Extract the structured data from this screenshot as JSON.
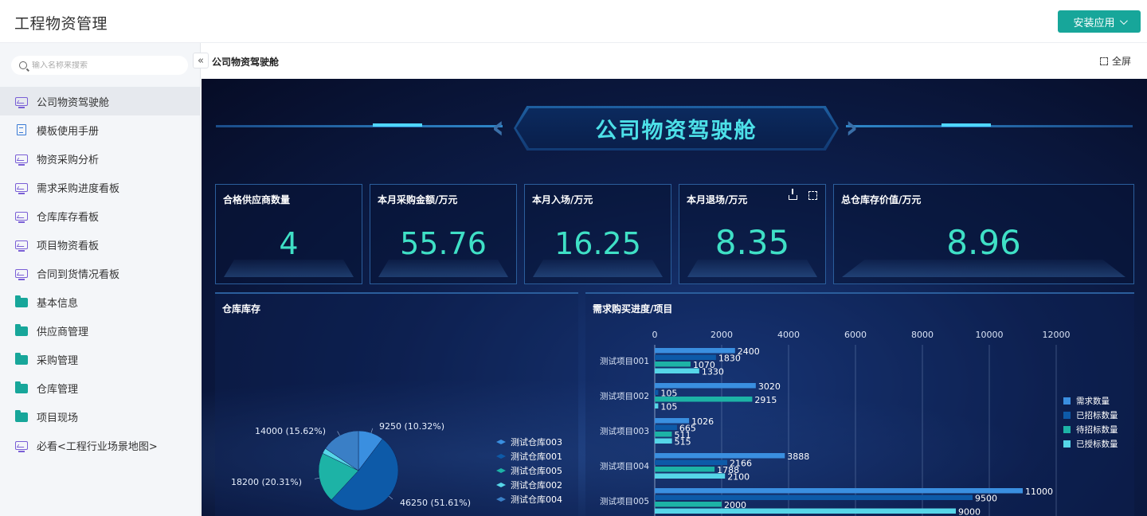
{
  "header": {
    "app_title": "工程物资管理",
    "install_label": "安装应用"
  },
  "sidebar": {
    "search_placeholder": "输入名称来搜索",
    "collapse_symbol": "«",
    "items": [
      {
        "label": "公司物资驾驶舱",
        "icon": "dashboard-screen-icon",
        "active": true
      },
      {
        "label": "模板使用手册",
        "icon": "document-icon"
      },
      {
        "label": "物资采购分析",
        "icon": "dashboard-screen-icon"
      },
      {
        "label": "需求采购进度看板",
        "icon": "dashboard-screen-icon"
      },
      {
        "label": "仓库库存看板",
        "icon": "dashboard-screen-icon"
      },
      {
        "label": "项目物资看板",
        "icon": "dashboard-screen-icon"
      },
      {
        "label": "合同到货情况看板",
        "icon": "dashboard-screen-icon"
      },
      {
        "label": "基本信息",
        "icon": "folder-icon"
      },
      {
        "label": "供应商管理",
        "icon": "folder-icon"
      },
      {
        "label": "采购管理",
        "icon": "folder-icon"
      },
      {
        "label": "仓库管理",
        "icon": "folder-icon"
      },
      {
        "label": "项目现场",
        "icon": "folder-icon"
      },
      {
        "label": "必看<工程行业场景地图>",
        "icon": "dashboard-screen-icon"
      }
    ]
  },
  "breadcrumb": {
    "current": "公司物资驾驶舱",
    "fullscreen_label": "全屏"
  },
  "dashboard": {
    "title": "公司物资驾驶舱",
    "kpis": [
      {
        "label": "合格供应商数量",
        "value": "4"
      },
      {
        "label": "本月采购金额/万元",
        "value": "55.76"
      },
      {
        "label": "本月入场/万元",
        "value": "16.25"
      },
      {
        "label": "本月退场/万元",
        "value": "8.35"
      },
      {
        "label": "总仓库存价值/万元",
        "value": "8.96"
      }
    ],
    "pie_panel_title": "仓库库存",
    "bar_panel_title": "需求购买进度/项目"
  },
  "colors": {
    "accent": "#17a69a",
    "kpi_value": "#3fe0c6",
    "title": "#4de0e8"
  },
  "chart_data": [
    {
      "type": "pie",
      "title": "仓库库存",
      "labels": [
        "测试仓库003",
        "测试仓库001",
        "测试仓库005",
        "测试仓库002",
        "测试仓库004"
      ],
      "values": [
        9250,
        46250,
        18200,
        2000,
        14000
      ],
      "slice_labels": [
        "9250 (10.32%)",
        "46250 (51.61%)",
        "18200 (20.31%)",
        "",
        "14000 (15.62%)"
      ],
      "colors": [
        "#3a8fe0",
        "#0d5aa8",
        "#1db3a6",
        "#56d6e8",
        "#3a7fc6"
      ],
      "legend": "right"
    },
    {
      "type": "bar",
      "orientation": "horizontal",
      "title": "需求购买进度/项目",
      "categories": [
        "测试项目001",
        "测试项目002",
        "测试项目003",
        "测试项目004",
        "测试项目005"
      ],
      "series": [
        {
          "name": "需求数量",
          "values": [
            2400,
            3020,
            1026,
            3888,
            11000
          ],
          "color": "#3a8fe0"
        },
        {
          "name": "已招标数量",
          "values": [
            1830,
            105,
            665,
            2166,
            9500
          ],
          "color": "#0d5aa8"
        },
        {
          "name": "待招标数量",
          "values": [
            1070,
            2915,
            511,
            1788,
            2000
          ],
          "color": "#1db3a6"
        },
        {
          "name": "已授标数量",
          "values": [
            1330,
            105,
            515,
            2100,
            9000
          ],
          "color": "#56d6e8"
        }
      ],
      "xticks": [
        0,
        2000,
        4000,
        6000,
        8000,
        10000,
        12000
      ],
      "xlim": [
        0,
        12000
      ],
      "grid": true,
      "legend": "right"
    }
  ]
}
